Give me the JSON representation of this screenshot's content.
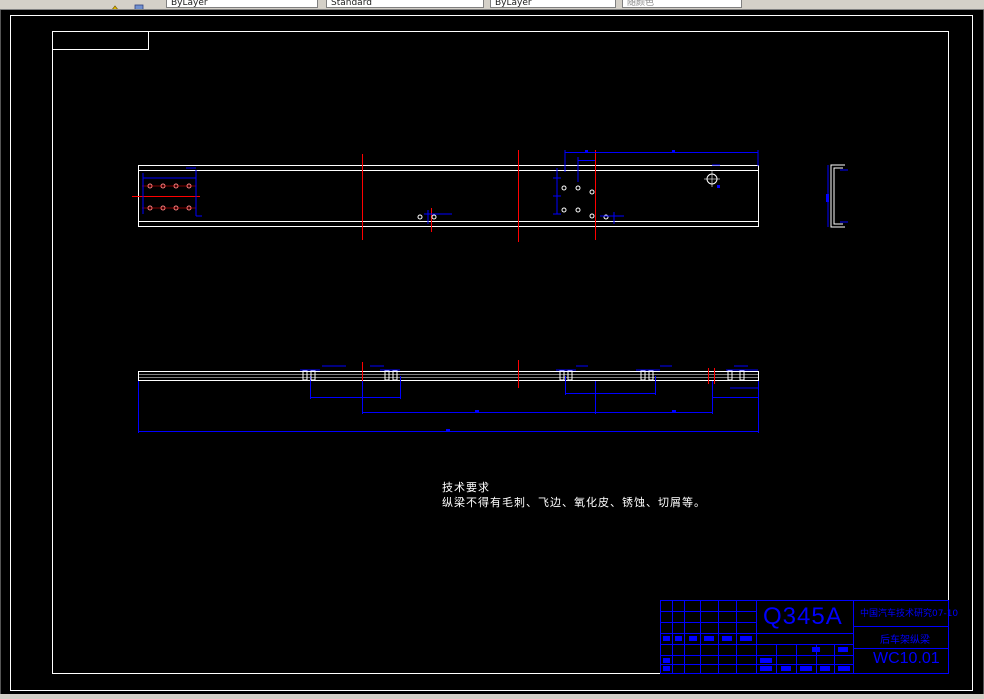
{
  "toolbar": {
    "fields": [
      "ByLayer",
      "Standard",
      "ByLayer",
      "随颜色"
    ]
  },
  "notes": {
    "title": "技术要求",
    "body": "纵梁不得有毛刺、飞边、氧化皮、锈蚀、切屑等。"
  },
  "title_block": {
    "material": "Q345A",
    "project": "中国汽车技术研究07-10",
    "part_name": "后车架纵梁",
    "drawing_no": "WC10.01"
  },
  "colors": {
    "outline": "#ffffff",
    "dimension": "#0000ff",
    "centerline": "#ff0000",
    "hole": "#ff8080",
    "background": "#000000"
  }
}
